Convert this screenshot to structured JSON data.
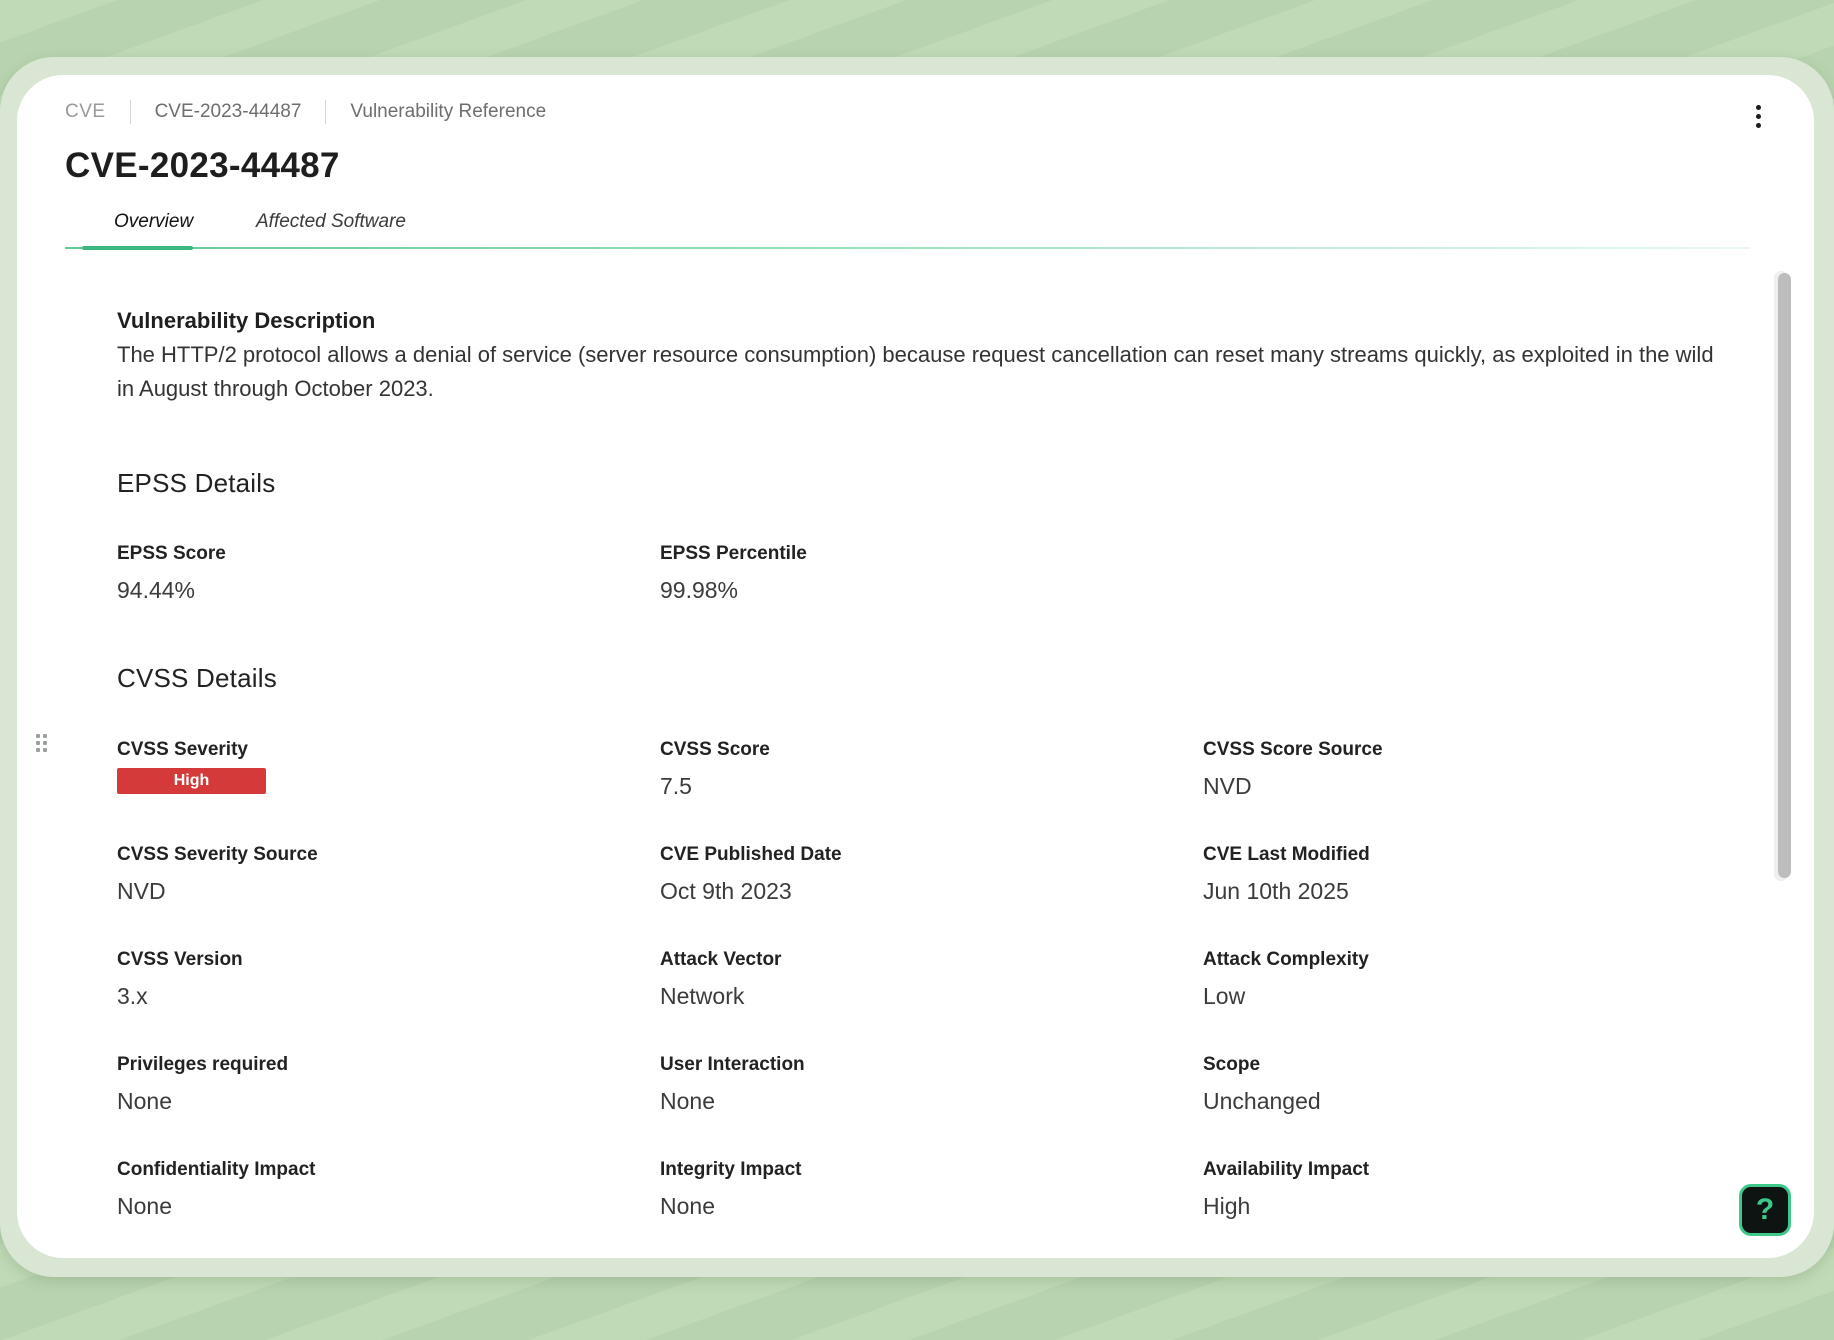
{
  "breadcrumb": {
    "items": [
      "CVE",
      "CVE-2023-44487",
      "Vulnerability Reference"
    ]
  },
  "page_title": "CVE-2023-44487",
  "tabs": [
    {
      "label": "Overview",
      "active": true
    },
    {
      "label": "Affected Software",
      "active": false
    }
  ],
  "description": {
    "label": "Vulnerability Description",
    "text": "The HTTP/2 protocol allows a denial of service (server resource consumption) because request cancellation can reset many streams quickly, as exploited in the wild in August through October 2023."
  },
  "epss": {
    "heading": "EPSS Details",
    "score_label": "EPSS Score",
    "score_value": "94.44%",
    "percentile_label": "EPSS Percentile",
    "percentile_value": "99.98%"
  },
  "cvss": {
    "heading": "CVSS Details",
    "severity_label": "CVSS Severity",
    "severity_value": "High",
    "severity_color": "#d43a3a",
    "score_label": "CVSS Score",
    "score_value": "7.5",
    "score_source_label": "CVSS Score Source",
    "score_source_value": "NVD",
    "severity_source_label": "CVSS Severity Source",
    "severity_source_value": "NVD",
    "published_label": "CVE Published Date",
    "published_value": "Oct 9th 2023",
    "modified_label": "CVE Last Modified",
    "modified_value": "Jun 10th 2025",
    "version_label": "CVSS Version",
    "version_value": "3.x",
    "attack_vector_label": "Attack Vector",
    "attack_vector_value": "Network",
    "attack_complexity_label": "Attack Complexity",
    "attack_complexity_value": "Low",
    "privileges_label": "Privileges required",
    "privileges_value": "None",
    "user_interaction_label": "User Interaction",
    "user_interaction_value": "None",
    "scope_label": "Scope",
    "scope_value": "Unchanged",
    "confidentiality_label": "Confidentiality Impact",
    "confidentiality_value": "None",
    "integrity_label": "Integrity Impact",
    "integrity_value": "None",
    "availability_label": "Availability Impact",
    "availability_value": "High"
  },
  "help": {
    "label": "?",
    "icon": "help-icon"
  },
  "colors": {
    "accent": "#3cb77d",
    "background": "#bcd8b2",
    "severity_high": "#d43a3a"
  }
}
